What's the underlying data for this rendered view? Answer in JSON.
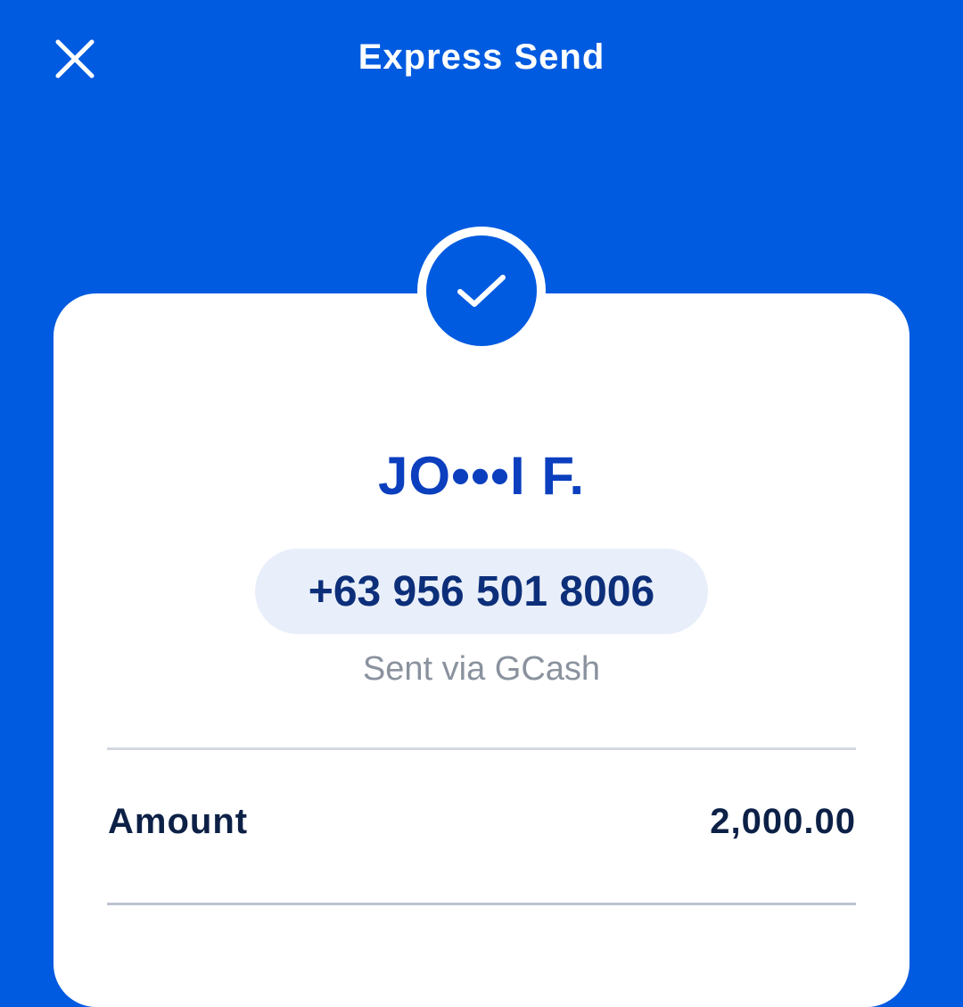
{
  "header": {
    "title": "Express Send",
    "close_icon": "close-icon"
  },
  "status": {
    "icon": "checkmark-icon"
  },
  "recipient": {
    "name": "JO•••I F.",
    "phone": "+63 956 501 8006",
    "channel": "Sent via GCash"
  },
  "details": {
    "amount_label": "Amount",
    "amount_value": "2,000.00"
  },
  "colors": {
    "background": "#015be0",
    "card": "#ffffff",
    "name": "#0b3fbe",
    "text_dark": "#0d2147",
    "muted": "#8a929e",
    "pill": "#e9effa"
  }
}
